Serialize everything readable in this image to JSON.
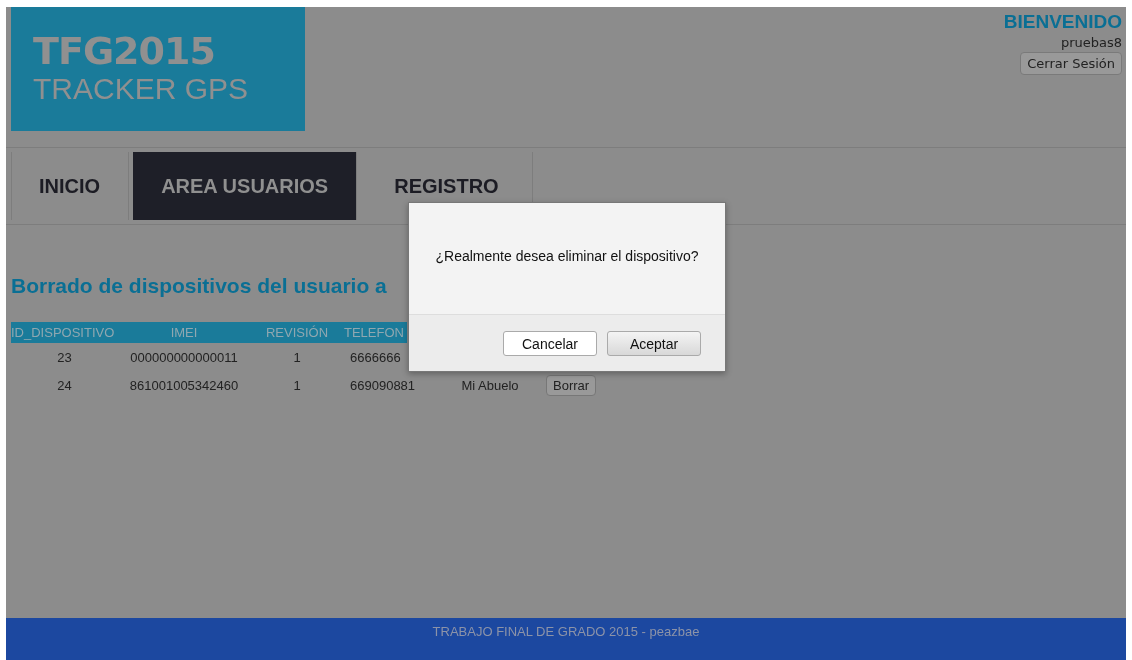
{
  "logo": {
    "line_1": "TFG2015",
    "line_2": "TRACKER GPS"
  },
  "user_panel": {
    "greeting": "BIENVENIDO",
    "username": "pruebas8",
    "logout_button": "Cerrar Sesión"
  },
  "tabs": [
    {
      "label": "INICIO",
      "selected": false
    },
    {
      "label": "AREA USUARIOS",
      "selected": true
    },
    {
      "label": "REGISTRO",
      "selected": false
    }
  ],
  "heading": "Borrado de dispositivos del usuario a",
  "table": {
    "columns": [
      "ID_DISPOSITIVO",
      "IMEI",
      "REVISIÓN",
      "TELEFON"
    ],
    "rows": [
      {
        "cells": [
          "23",
          "000000000000011",
          "1",
          "6666666"
        ]
      },
      {
        "cells": [
          "24",
          "861001005342460",
          "1",
          "669090881",
          "Mi Abuelo"
        ],
        "button": "Borrar"
      }
    ]
  },
  "dialog": {
    "message": "¿Realmente desea eliminar el dispositivo?",
    "buttons": [
      "Cancelar",
      "Aceptar"
    ]
  },
  "footer": "TRABAJO FINAL DE GRADO 2015 - peazbae"
}
